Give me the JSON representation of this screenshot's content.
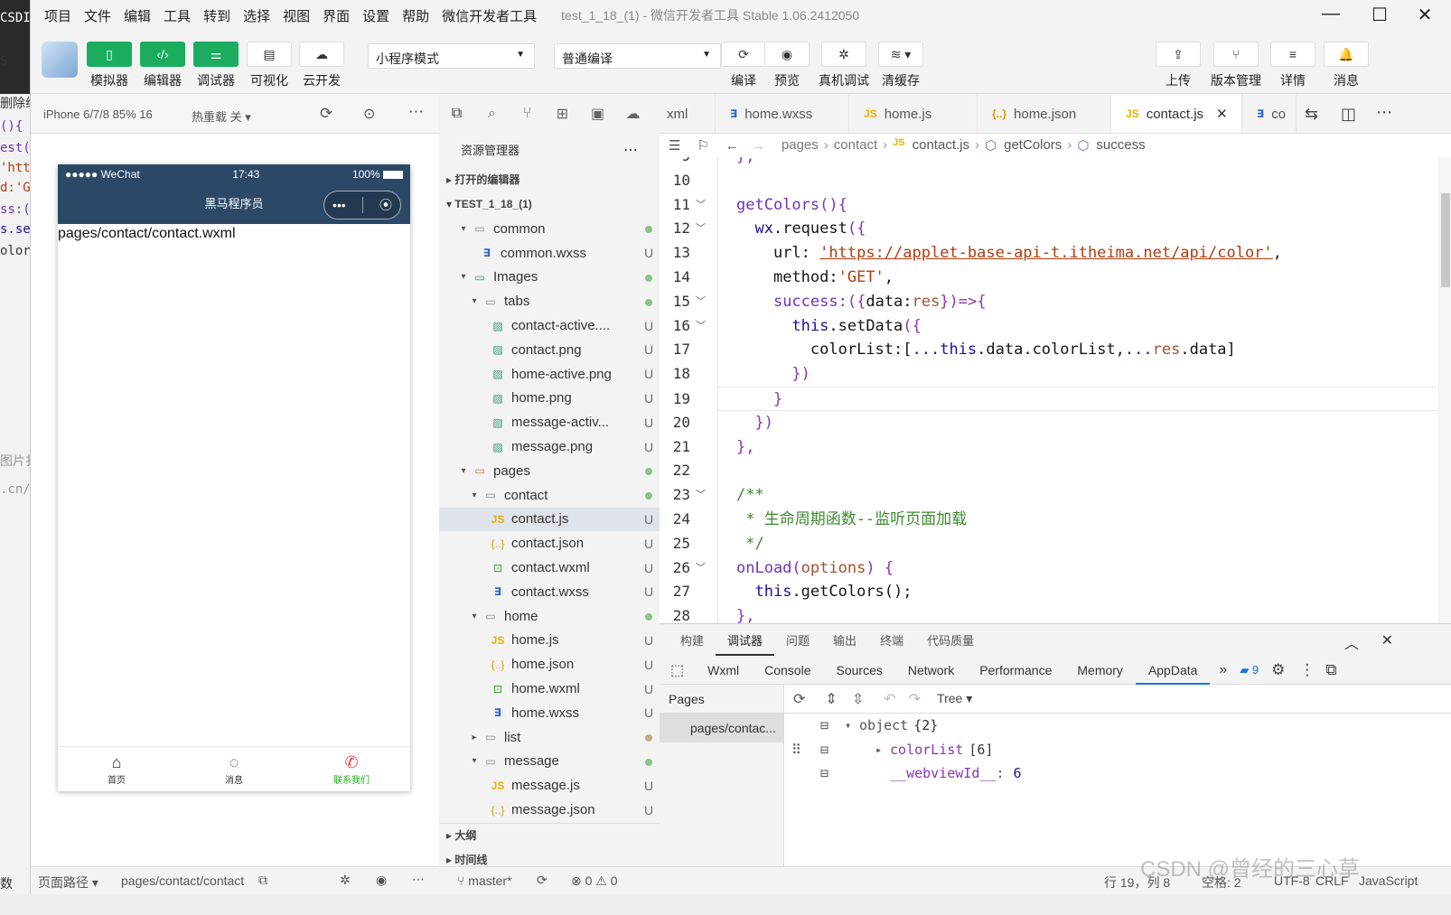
{
  "menubar": {
    "items": [
      "项目",
      "文件",
      "编辑",
      "工具",
      "转到",
      "选择",
      "视图",
      "界面",
      "设置",
      "帮助",
      "微信开发者工具"
    ],
    "title": "test_1_18_(1) - 微信开发者工具 Stable 1.06.2412050"
  },
  "leftstrip": {
    "lines": [
      "CSDI",
      "S",
      "删除线",
      "(){",
      "est(",
      "'htt",
      "d:'G",
      "ss:(",
      "s.se",
      "olor",
      "图片扌",
      ".cn/c",
      "数"
    ]
  },
  "toolbar": {
    "buttons": [
      {
        "label": "模拟器",
        "icon": "phone-icon"
      },
      {
        "label": "编辑器",
        "icon": "code-icon"
      },
      {
        "label": "调试器",
        "icon": "debug-icon"
      },
      {
        "label": "可视化",
        "icon": "layout-icon"
      },
      {
        "label": "云开发",
        "icon": "cloud-icon"
      }
    ],
    "mode_select": "小程序模式",
    "compile_select": "普通编译",
    "actions": [
      {
        "label": "编译",
        "icon": "refresh-icon"
      },
      {
        "label": "预览",
        "icon": "eye-icon"
      },
      {
        "label": "真机调试",
        "icon": "bug-icon"
      },
      {
        "label": "清缓存",
        "icon": "layers-icon"
      }
    ],
    "right_actions": [
      {
        "label": "上传",
        "icon": "upload-icon"
      },
      {
        "label": "版本管理",
        "icon": "branch-icon"
      },
      {
        "label": "详情",
        "icon": "menu-icon"
      },
      {
        "label": "消息",
        "icon": "bell-icon"
      }
    ]
  },
  "simulator": {
    "device": "iPhone 6/7/8 85% 16",
    "hot_reload": "热重载 关",
    "status_carrier": "●●●●● WeChat",
    "status_time": "17:43",
    "status_battery": "100%",
    "nav_title": "黑马程序员",
    "body_text": "pages/contact/contact.wxml",
    "tabs": [
      {
        "label": "首页",
        "active": false
      },
      {
        "label": "消息",
        "active": false
      },
      {
        "label": "联系我们",
        "active": true
      }
    ],
    "active_color": "#1aad19"
  },
  "explorer": {
    "title": "资源管理器",
    "open_editors": "打开的编辑器",
    "project": "TEST_1_18_(1)",
    "outline": "大纲",
    "timeline": "时间线",
    "tree": [
      {
        "name": "common",
        "type": "folder",
        "depth": 1,
        "status": "dot"
      },
      {
        "name": "common.wxss",
        "type": "wxss",
        "depth": 2,
        "status": "U"
      },
      {
        "name": "Images",
        "type": "folder-img",
        "depth": 1,
        "status": "dot"
      },
      {
        "name": "tabs",
        "type": "folder",
        "depth": 2,
        "status": "dot"
      },
      {
        "name": "contact-active....",
        "type": "png",
        "depth": 3,
        "status": "U"
      },
      {
        "name": "contact.png",
        "type": "png",
        "depth": 3,
        "status": "U"
      },
      {
        "name": "home-active.png",
        "type": "png",
        "depth": 3,
        "status": "U"
      },
      {
        "name": "home.png",
        "type": "png",
        "depth": 3,
        "status": "U"
      },
      {
        "name": "message-activ...",
        "type": "png",
        "depth": 3,
        "status": "U"
      },
      {
        "name": "message.png",
        "type": "png",
        "depth": 3,
        "status": "U"
      },
      {
        "name": "pages",
        "type": "folder-pages",
        "depth": 1,
        "status": "dot"
      },
      {
        "name": "contact",
        "type": "folder",
        "depth": 2,
        "status": "dot"
      },
      {
        "name": "contact.js",
        "type": "js",
        "depth": 3,
        "status": "U",
        "selected": true
      },
      {
        "name": "contact.json",
        "type": "json",
        "depth": 3,
        "status": "U"
      },
      {
        "name": "contact.wxml",
        "type": "wxml",
        "depth": 3,
        "status": "U"
      },
      {
        "name": "contact.wxss",
        "type": "wxss",
        "depth": 3,
        "status": "U"
      },
      {
        "name": "home",
        "type": "folder",
        "depth": 2,
        "status": "dot"
      },
      {
        "name": "home.js",
        "type": "js",
        "depth": 3,
        "status": "U"
      },
      {
        "name": "home.json",
        "type": "json",
        "depth": 3,
        "status": "U"
      },
      {
        "name": "home.wxml",
        "type": "wxml",
        "depth": 3,
        "status": "U"
      },
      {
        "name": "home.wxss",
        "type": "wxss",
        "depth": 3,
        "status": "U"
      },
      {
        "name": "list",
        "type": "folder-collapsed",
        "depth": 2,
        "status": "dot-brown"
      },
      {
        "name": "message",
        "type": "folder",
        "depth": 2,
        "status": "dot"
      },
      {
        "name": "message.js",
        "type": "js",
        "depth": 3,
        "status": "U"
      },
      {
        "name": "message.json",
        "type": "json",
        "depth": 3,
        "status": "U"
      }
    ]
  },
  "editor": {
    "tabs": [
      {
        "label": "xml",
        "icon": "",
        "active": false
      },
      {
        "label": "home.wxss",
        "icon": "wxss",
        "active": false
      },
      {
        "label": "home.js",
        "icon": "js",
        "active": false
      },
      {
        "label": "home.json",
        "icon": "json",
        "active": false
      },
      {
        "label": "contact.js",
        "icon": "js",
        "active": true
      },
      {
        "label": "co",
        "icon": "wxss",
        "active": false
      }
    ],
    "breadcrumb": [
      "pages",
      "contact",
      "contact.js",
      "getColors",
      "success"
    ],
    "lines": [
      {
        "n": "9",
        "fold": false,
        "code": [
          [
            "pu",
            "},"
          ]
        ]
      },
      {
        "n": "10",
        "fold": false,
        "code": []
      },
      {
        "n": "11",
        "fold": true,
        "code": [
          [
            "fn",
            "getColors"
          ],
          [
            "pu",
            "(){"
          ]
        ]
      },
      {
        "n": "12",
        "fold": true,
        "code": [
          [
            "",
            "  "
          ],
          [
            "kw",
            "wx"
          ],
          [
            "pr",
            ".request"
          ],
          [
            "pu",
            "({"
          ]
        ]
      },
      {
        "n": "13",
        "fold": false,
        "code": [
          [
            "",
            "    "
          ],
          [
            "pr",
            "url: "
          ],
          [
            "str",
            "'https://applet-base-api-t.itheima.net/api/color'"
          ],
          [
            "pr",
            ","
          ]
        ]
      },
      {
        "n": "14",
        "fold": false,
        "code": [
          [
            "",
            "    "
          ],
          [
            "pr",
            "method:"
          ],
          [
            "str",
            "'GET'"
          ],
          [
            "pr",
            ","
          ]
        ]
      },
      {
        "n": "15",
        "fold": true,
        "code": [
          [
            "",
            "    "
          ],
          [
            "fn",
            "success:"
          ],
          [
            "pu",
            "("
          ],
          [
            "pu",
            "{"
          ],
          [
            "pr",
            "data:"
          ],
          [
            "pm",
            "res"
          ],
          [
            "pu",
            "}"
          ],
          [
            "pu",
            ")=>{"
          ]
        ]
      },
      {
        "n": "16",
        "fold": true,
        "code": [
          [
            "",
            "      "
          ],
          [
            "kw",
            "this"
          ],
          [
            "pr",
            ".setData"
          ],
          [
            "pu",
            "({"
          ]
        ]
      },
      {
        "n": "17",
        "fold": false,
        "code": [
          [
            "",
            "        "
          ],
          [
            "pr",
            "colorList:["
          ],
          [
            "kw",
            "..."
          ],
          [
            "kw",
            "this"
          ],
          [
            "pr",
            ".data.colorList,"
          ],
          [
            "kw",
            "..."
          ],
          [
            "pm",
            "res"
          ],
          [
            "pr",
            ".data]"
          ]
        ]
      },
      {
        "n": "18",
        "fold": false,
        "code": [
          [
            "",
            "      "
          ],
          [
            "pu",
            "})"
          ]
        ]
      },
      {
        "n": "19",
        "fold": false,
        "code": [
          [
            "",
            "    "
          ],
          [
            "pu",
            "}"
          ]
        ],
        "current": true
      },
      {
        "n": "20",
        "fold": false,
        "code": [
          [
            "",
            "  "
          ],
          [
            "pu",
            "})"
          ]
        ]
      },
      {
        "n": "21",
        "fold": false,
        "code": [
          [
            "pu",
            "},"
          ]
        ]
      },
      {
        "n": "22",
        "fold": false,
        "code": []
      },
      {
        "n": "23",
        "fold": true,
        "code": [
          [
            "cm",
            "/**"
          ]
        ]
      },
      {
        "n": "24",
        "fold": false,
        "code": [
          [
            "cm",
            " * 生命周期函数--监听页面加载"
          ]
        ]
      },
      {
        "n": "25",
        "fold": false,
        "code": [
          [
            "cm",
            " */"
          ]
        ]
      },
      {
        "n": "26",
        "fold": true,
        "code": [
          [
            "fn",
            "onLoad"
          ],
          [
            "pu",
            "("
          ],
          [
            "pm",
            "options"
          ],
          [
            "pu",
            ") {"
          ]
        ]
      },
      {
        "n": "27",
        "fold": false,
        "code": [
          [
            "",
            "  "
          ],
          [
            "kw",
            "this"
          ],
          [
            "pr",
            ".getColors();"
          ]
        ]
      },
      {
        "n": "28",
        "fold": false,
        "code": [
          [
            "pu",
            "},"
          ]
        ]
      }
    ]
  },
  "devtools": {
    "panel_tabs": [
      "构建",
      "调试器",
      "问题",
      "输出",
      "终端",
      "代码质量"
    ],
    "active_panel": "调试器",
    "sub_tabs": [
      "Wxml",
      "Console",
      "Sources",
      "Network",
      "Performance",
      "Memory",
      "AppData"
    ],
    "active_sub": "AppData",
    "message_count": "9",
    "pages_label": "Pages",
    "page_item": "pages/contac...",
    "view_mode": "Tree",
    "tree": [
      {
        "key": "object",
        "value": "{2}",
        "depth": 0
      },
      {
        "key": "colorList",
        "value": "[6]",
        "depth": 1
      },
      {
        "key": "__webviewId__",
        "value": "6",
        "depth": 1
      }
    ]
  },
  "statusbar": {
    "page_path_label": "页面路径",
    "page_path": "pages/contact/contact",
    "branch": "master*",
    "problems": "⊗ 0 ⚠ 0",
    "position": "行 19，列 8",
    "spaces": "空格: 2",
    "encoding": "UTF-8",
    "eol": "CRLF",
    "language": "JavaScript",
    "watermark": "CSDN @曾经的三心草"
  }
}
